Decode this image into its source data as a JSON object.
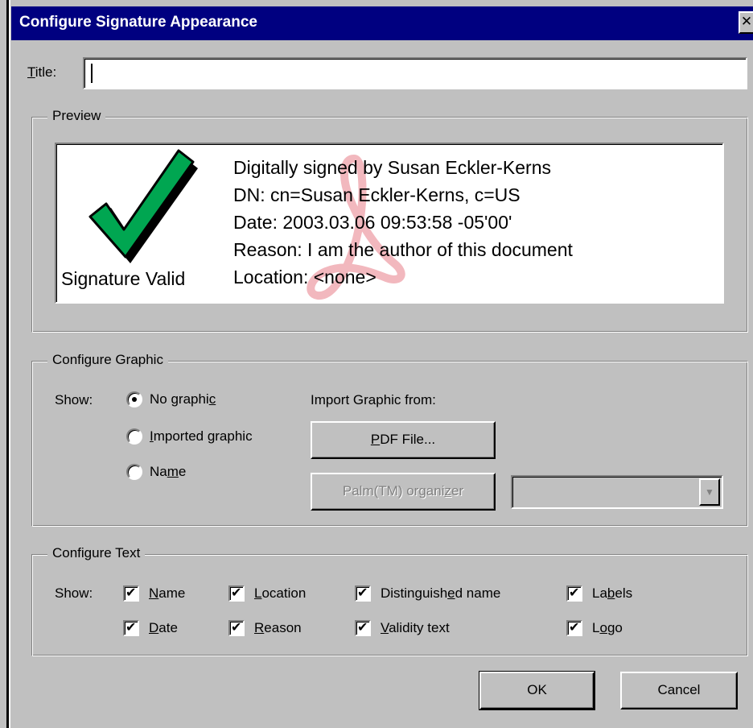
{
  "window": {
    "title": "Configure Signature Appearance",
    "close_glyph": "✕"
  },
  "title_field": {
    "label_u": "T",
    "label_rest": "itle:",
    "value": ""
  },
  "preview": {
    "legend": "Preview",
    "graphic_caption": "Signature Valid",
    "lines": [
      "Digitally signed by Susan Eckler-Kerns",
      "DN: cn=Susan Eckler-Kerns, c=US",
      "Date: 2003.03.06 09:53:58 -05'00'",
      "Reason: I am the author of this document",
      "Location: <none>"
    ],
    "check_color": "#00a651",
    "watermark_color": "#f2b8be"
  },
  "graphic": {
    "legend": "Configure Graphic",
    "show_label": "Show:",
    "options": [
      {
        "pre": "No graphi",
        "u": "c",
        "post": "",
        "checked": true
      },
      {
        "pre": "",
        "u": "I",
        "post": "mported graphic",
        "checked": false
      },
      {
        "pre": "Na",
        "u": "m",
        "post": "e",
        "checked": false
      }
    ],
    "import_label": "Import Graphic from:",
    "pdf_button": {
      "pre": "",
      "u": "P",
      "post": "DF File..."
    },
    "palm_button": {
      "pre": "Palm(TM) organi",
      "u": "z",
      "post": "er"
    },
    "palm_select_value": ""
  },
  "text": {
    "legend": "Configure Text",
    "show_label": "Show:",
    "checks": [
      {
        "pre": "",
        "u": "N",
        "post": "ame",
        "checked": true
      },
      {
        "pre": "",
        "u": "L",
        "post": "ocation",
        "checked": true
      },
      {
        "pre": "Distinguish",
        "u": "e",
        "post": "d name",
        "checked": true
      },
      {
        "pre": "La",
        "u": "b",
        "post": "els",
        "checked": true
      },
      {
        "pre": "",
        "u": "D",
        "post": "ate",
        "checked": true
      },
      {
        "pre": "",
        "u": "R",
        "post": "eason",
        "checked": true
      },
      {
        "pre": "",
        "u": "V",
        "post": "alidity text",
        "checked": true
      },
      {
        "pre": "L",
        "u": "o",
        "post": "go",
        "checked": true
      }
    ]
  },
  "buttons": {
    "ok": "OK",
    "cancel": "Cancel"
  }
}
